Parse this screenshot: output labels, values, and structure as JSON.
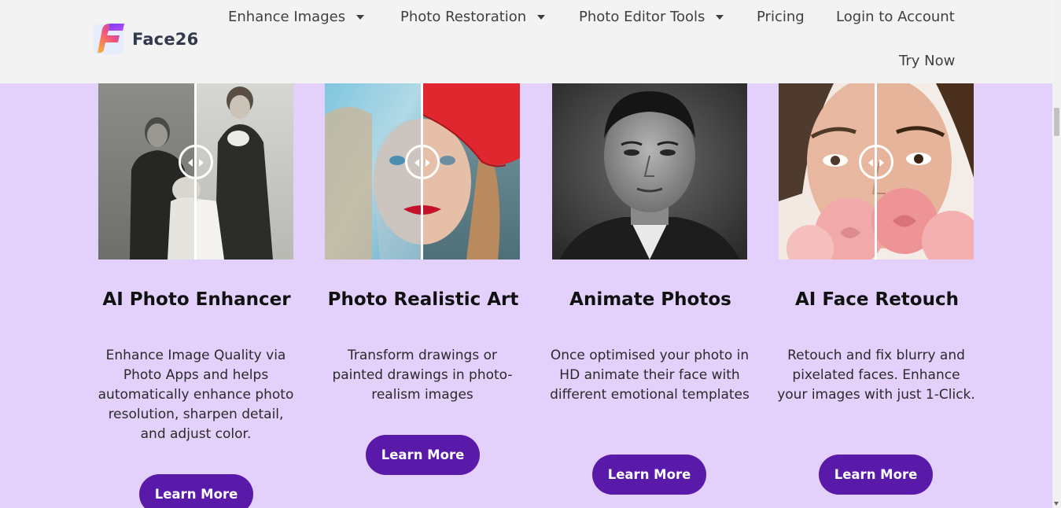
{
  "header": {
    "logo_text": "Face26",
    "nav": [
      {
        "label": "Enhance Images",
        "has_dropdown": true
      },
      {
        "label": "Photo Restoration",
        "has_dropdown": true
      },
      {
        "label": "Photo Editor Tools",
        "has_dropdown": true
      },
      {
        "label": "Pricing",
        "has_dropdown": false
      },
      {
        "label": "Login to Account",
        "has_dropdown": false
      },
      {
        "label": "Try Now",
        "has_dropdown": false
      }
    ]
  },
  "cards": [
    {
      "title": "AI Photo Enhancer",
      "description": "Enhance Image Quality via Photo Apps and helps automatically enhance photo resolution, sharpen detail, and adjust color.",
      "button": "Learn More",
      "image": "before-after-old-family-photo"
    },
    {
      "title": "Photo Realistic Art",
      "description": "Transform drawings or painted drawings in photo-realism images",
      "button": "Learn More",
      "image": "before-after-painting-to-photo"
    },
    {
      "title": "Animate Photos",
      "description": "Once optimised your photo in HD animate their face with different emotional templates",
      "button": "Learn More",
      "image": "black-white-portrait"
    },
    {
      "title": "AI Face Retouch",
      "description": "Retouch and fix blurry and pixelated faces. Enhance your images with just 1-Click.",
      "button": "Learn More",
      "image": "before-after-face-retouch"
    }
  ],
  "colors": {
    "page_bg": "#e4d1fb",
    "header_bg": "#f3f3f3",
    "button_bg": "#5a1aa9",
    "button_text": "#ffffff"
  }
}
